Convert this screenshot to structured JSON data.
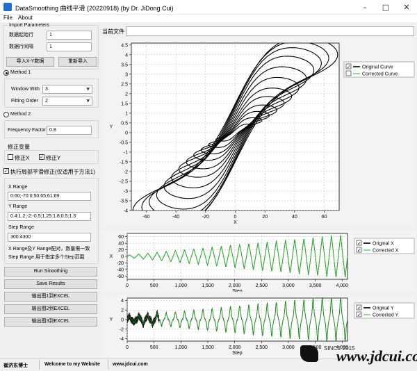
{
  "window": {
    "title": "DataSmoothing 曲线平滑 (20220918) (by Dr. JiDong Cui)",
    "menu": [
      "File",
      "About"
    ]
  },
  "import": {
    "group_title": "Import Parameters",
    "start_row_label": "数据起始行",
    "start_row_value": "1",
    "row_interval_label": "数据行间隔",
    "row_interval_value": "1",
    "import_xy_button": "导入X-Y数据",
    "reimport_button": "重新导入"
  },
  "current_file_label": "当前文件",
  "method1": {
    "label": "Method 1",
    "selected": true,
    "window_width_label": "Window With",
    "window_width_value": "3",
    "fitting_order_label": "Fitting Order",
    "fitting_order_value": "2"
  },
  "method2": {
    "label": "Method 2",
    "selected": false,
    "frequency_factor_label": "Frequency Factor",
    "frequency_factor_value": "0.8"
  },
  "correction": {
    "title": "修正变量",
    "x_label": "修正X",
    "x_checked": false,
    "y_label": "修正Y",
    "y_checked": true
  },
  "local": {
    "checkbox_label": "执行局部平滑修正(仅适用于方法1)",
    "checked": true,
    "x_range_label": "X Range",
    "x_range_value": "0:60;-70:0;50:65;61:69",
    "y_range_label": "Y Range",
    "y_range_value": "0.4:1.2;-2:-0.5;1.25:1.8;0.5:1.3",
    "step_range_label": "Step Range",
    "step_range_value": "300:4300",
    "note1": "X Range及Y Range配对，数量需一致",
    "note2": "Step Range 用于指定多个Step范围"
  },
  "buttons": {
    "run": "Run Smoothing",
    "save": "Save Results",
    "export1": "输出图1到EXCEL",
    "export2": "输出图2到EXCEL",
    "export3": "输出图3到EXCEL"
  },
  "status": {
    "author": "崔济东博士",
    "welcome": "Welcome to my Website",
    "url": "www.jdcui.com"
  },
  "watermark": {
    "since": "SINCE 2015",
    "site": "www.jdcui.com"
  },
  "colors": {
    "original": "#000000",
    "corrected": "#22bb22",
    "corrected_y_line": "#1a9a1a"
  },
  "chart_data": [
    {
      "type": "line",
      "title": "",
      "xlabel": "X",
      "ylabel": "Y",
      "xlim": [
        -70,
        70
      ],
      "ylim": [
        -4,
        4.6
      ],
      "x_ticks": [
        -60,
        -40,
        -20,
        0,
        20,
        40,
        60
      ],
      "y_ticks": [
        4.5,
        4,
        3.5,
        3,
        2.5,
        2,
        1.5,
        1,
        0.5,
        0,
        -0.5,
        -1,
        -1.5,
        -2,
        -2.5,
        -3,
        -3.5,
        -4
      ],
      "grid": true,
      "legend_position": "top-right",
      "series": [
        {
          "name": "Original Curve",
          "shown": true,
          "cycles": [
            [
              13,
              0.4
            ],
            [
              18,
              0.7
            ],
            [
              23,
              1.0
            ],
            [
              28,
              1.3
            ],
            [
              33,
              1.7
            ],
            [
              38,
              2.1
            ],
            [
              43,
              2.6
            ],
            [
              48,
              3.1
            ],
            [
              53,
              3.6
            ],
            [
              58,
              4.0
            ],
            [
              63,
              4.3
            ],
            [
              69,
              4.5
            ]
          ]
        },
        {
          "name": "Corrected Curve",
          "shown": false
        }
      ]
    },
    {
      "type": "line",
      "xlabel": "Step",
      "ylabel": "X",
      "xlim": [
        0,
        4100
      ],
      "ylim": [
        -70,
        70
      ],
      "x_ticks": [
        0,
        500,
        1000,
        1500,
        2000,
        2500,
        3000,
        3500,
        4000
      ],
      "y_ticks": [
        60,
        40,
        20,
        0,
        -20,
        -40,
        -60
      ],
      "grid": true,
      "legend_position": "top-right",
      "series": [
        {
          "name": "Original X",
          "shown": true
        },
        {
          "name": "Corrected X",
          "shown": true
        }
      ]
    },
    {
      "type": "line",
      "xlabel": "Step",
      "ylabel": "Y",
      "xlim": [
        0,
        4100
      ],
      "ylim": [
        -4.5,
        4.5
      ],
      "x_ticks": [
        0,
        500,
        1000,
        1500,
        2000,
        2500,
        3000,
        3500,
        4000
      ],
      "y_ticks": [
        4,
        2,
        0,
        -2,
        -4
      ],
      "grid": true,
      "legend_position": "top-right",
      "series": [
        {
          "name": "Original Y",
          "shown": true
        },
        {
          "name": "Corrected Y",
          "shown": true
        }
      ]
    }
  ]
}
